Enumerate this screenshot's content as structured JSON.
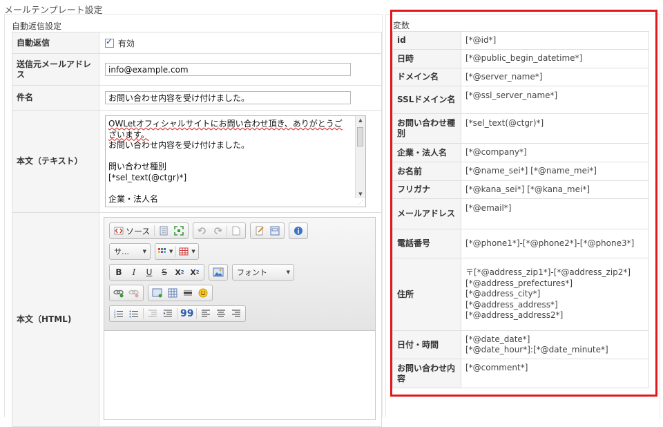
{
  "page": {
    "title": "メールテンプレート設定"
  },
  "auto_reply": {
    "section_title": "自動返信設定",
    "rows": {
      "enabled": {
        "label": "自動返信",
        "checkbox_label": "有効",
        "checked": true
      },
      "from": {
        "label": "送信元メールアドレス",
        "value": "info@example.com"
      },
      "subject": {
        "label": "件名",
        "value": "お問い合わせ内容を受け付けました。"
      },
      "body_text": {
        "label": "本文（テキスト）",
        "line1": "OWLetオフィシャルサイトにお問い合わせ頂き、ありがとうございます。",
        "line2": "お問い合わせ内容を受け付けました。",
        "line3": "",
        "line4": "問い合わせ種別",
        "line5": "[*sel_text(@ctgr)*]",
        "line6": "",
        "line7": "企業・法人名"
      },
      "body_html": {
        "label": "本文（HTML)"
      }
    }
  },
  "editor": {
    "source_label": "ソース",
    "style_combo": "サ…",
    "font_combo": "フォント",
    "bold": "B",
    "italic": "I",
    "underline": "U",
    "strike": "S",
    "subscript": "X",
    "superscript": "X",
    "quote": "99"
  },
  "variables": {
    "section_title": "変数",
    "rows": [
      {
        "key": "id",
        "value": "[*@id*]"
      },
      {
        "key": "日時",
        "value": "[*@public_begin_datetime*]"
      },
      {
        "key": "ドメイン名",
        "value": "[*@server_name*]"
      },
      {
        "key": "SSLドメイン名",
        "value": "[*@ssl_server_name*]"
      },
      {
        "key": "お問い合わせ種別",
        "value": "[*sel_text(@ctgr)*]"
      },
      {
        "key": "企業・法人名",
        "value": "[*@company*]"
      },
      {
        "key": "お名前",
        "value": "[*@name_sei*] [*@name_mei*]"
      },
      {
        "key": "フリガナ",
        "value": "[*@kana_sei*] [*@kana_mei*]"
      },
      {
        "key": "メールアドレス",
        "value": "[*@email*]"
      },
      {
        "key": "電話番号",
        "value": "[*@phone1*]-[*@phone2*]-[*@phone3*]"
      },
      {
        "key": "住所",
        "value": "〒[*@address_zip1*]-[*@address_zip2*]\n[*@address_prefectures*]\n[*@address_city*]\n[*@address_address*]\n[*@address_address2*]"
      },
      {
        "key": "日付・時間",
        "value": "[*@date_date*]\n[*@date_hour*]:[*@date_minute*]"
      },
      {
        "key": "お問い合わせ内容",
        "value": "[*@comment*]"
      }
    ]
  },
  "colors": {
    "highlight_frame": "#e2161b",
    "label_bg": "#f5f5f5",
    "border": "#dedede"
  }
}
